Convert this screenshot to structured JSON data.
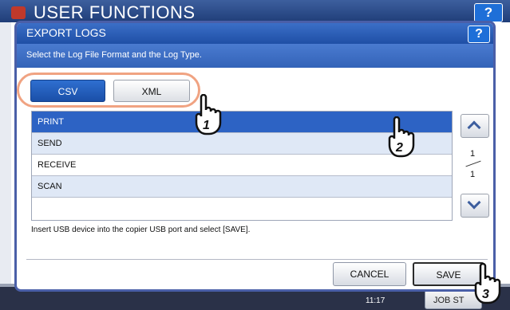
{
  "background": {
    "app_title": "USER FUNCTIONS",
    "help_label": "?",
    "time": "11:17",
    "job_status_label": "JOB ST"
  },
  "dialog": {
    "title": "EXPORT LOGS",
    "help_label": "?",
    "instruction": "Select the Log File Format and the Log Type.",
    "formats": [
      {
        "label": "CSV",
        "selected": true
      },
      {
        "label": "XML",
        "selected": false
      }
    ],
    "log_types": [
      {
        "label": "PRINT",
        "selected": true
      },
      {
        "label": "SEND",
        "selected": false
      },
      {
        "label": "RECEIVE",
        "selected": false
      },
      {
        "label": "SCAN",
        "selected": false
      },
      {
        "label": "",
        "selected": false
      }
    ],
    "pager": {
      "current": "1",
      "total": "1"
    },
    "note": "Insert USB device into the copier USB port and select [SAVE].",
    "cancel_label": "CANCEL",
    "save_label": "SAVE"
  },
  "callouts": [
    "1",
    "2",
    "3"
  ],
  "colors": {
    "accent_blue": "#2d63c4",
    "callout_outline": "#f0a382",
    "title_bar": "#1f4fa6"
  }
}
